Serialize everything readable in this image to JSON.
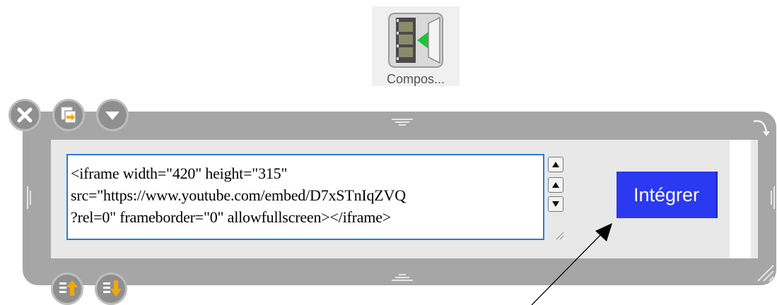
{
  "desktop_icon": {
    "label": "Compos...",
    "icon": "film-export-icon"
  },
  "widget": {
    "controls_top": [
      "close-icon",
      "copy-icon",
      "collapse-icon"
    ],
    "controls_bottom": [
      "move-up-icon",
      "move-down-icon"
    ],
    "code_lines": [
      "<iframe width=\"420\" height=\"315\"",
      "src=\"https://www.youtube.com/embed/D7xSTnIqZVQ",
      "?rel=0\" frameborder=\"0\" allowfullscreen></iframe>"
    ],
    "embed_button": "Intégrer"
  },
  "colors": {
    "frame": "#a6a6a6",
    "button": "#2b39f0",
    "textarea_border": "#2d7ad6",
    "control": "#8f8f8f"
  }
}
